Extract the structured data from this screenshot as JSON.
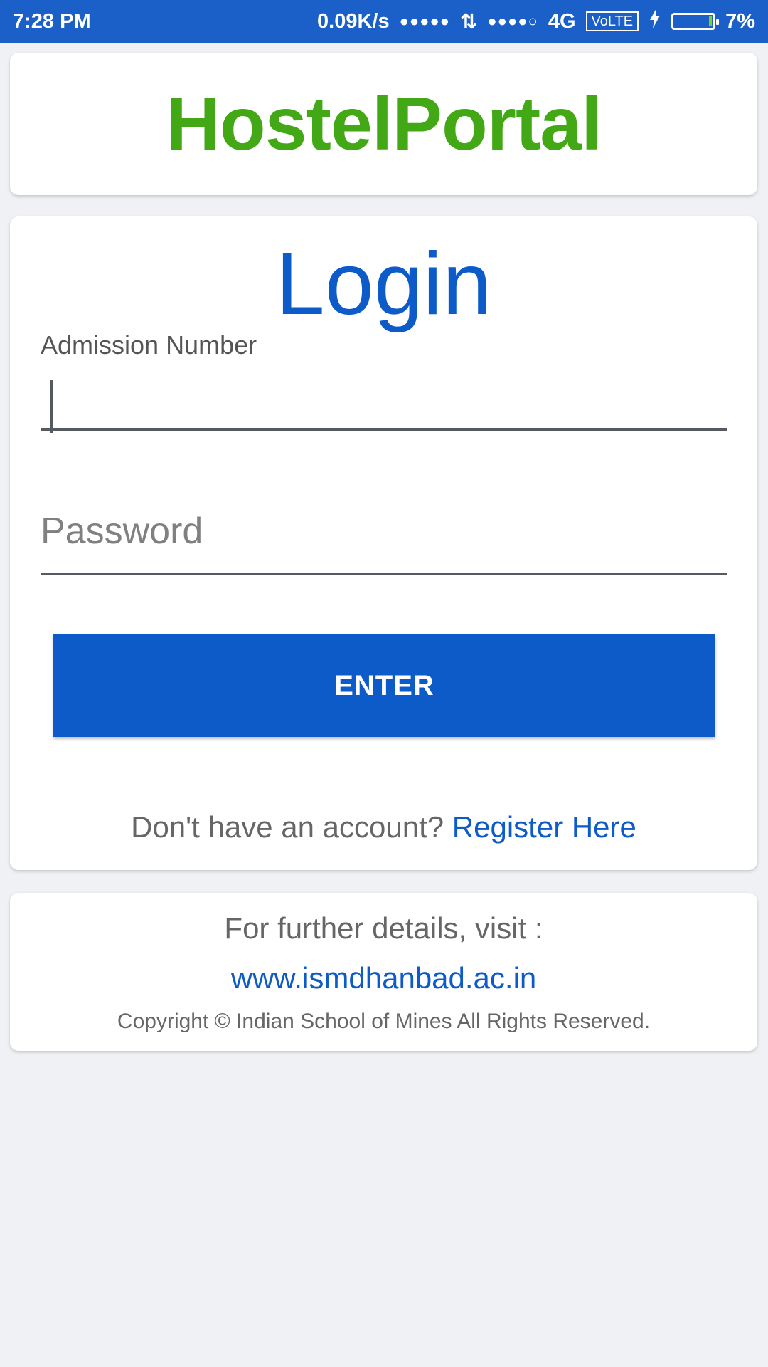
{
  "status_bar": {
    "time": "7:28 PM",
    "net_speed": "0.09K/s",
    "signal1": "●●●●●",
    "data_arrows": "⇅",
    "signal2": "●●●●○",
    "network": "4G",
    "volte": "VoLTE",
    "battery_percent": "7%",
    "battery_level": 0.07,
    "colors": {
      "bar": "#1b5fc8",
      "battery_fill": "#7ed321"
    }
  },
  "header": {
    "brand": "HostelPortal",
    "brand_color": "#43a815"
  },
  "login": {
    "heading": "Login",
    "admission_label": "Admission Number",
    "admission_value": "",
    "password_placeholder": "Password",
    "password_value": "",
    "enter_label": "ENTER",
    "no_account_text": "Don't have an account?",
    "register_label": "Register Here",
    "accent_color": "#0d5bc8"
  },
  "footer": {
    "details_text": "For further details, visit :",
    "website": "www.ismdhanbad.ac.in",
    "copyright": "Copyright © Indian School of Mines  All Rights Reserved."
  }
}
